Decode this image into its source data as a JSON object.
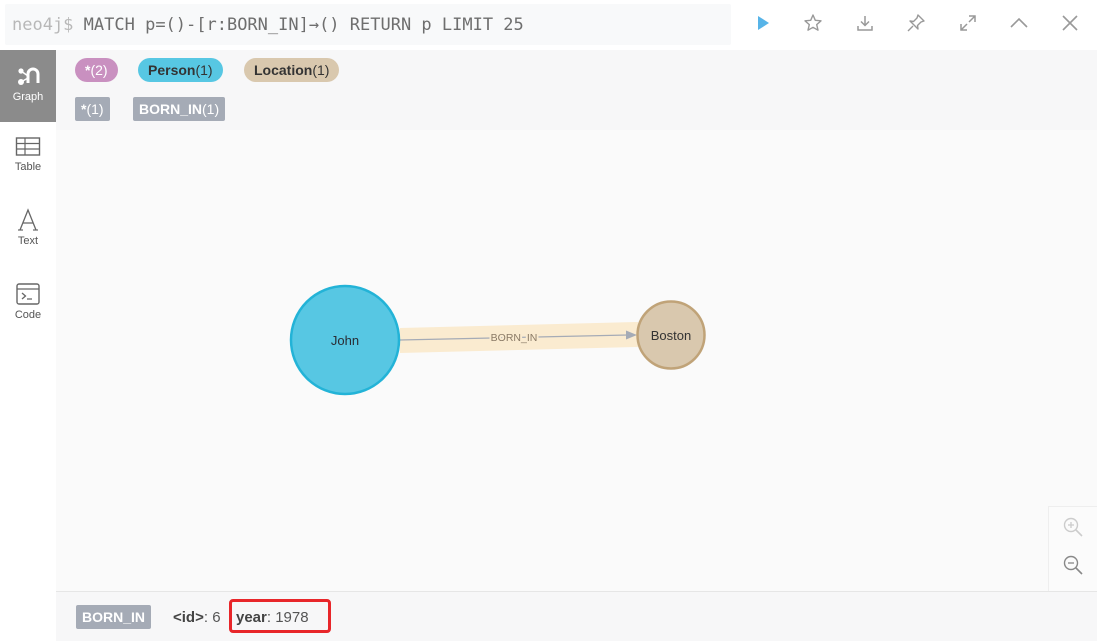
{
  "query": {
    "prompt": "neo4j$",
    "text": "MATCH p=()-[r:BORN_IN]→() RETURN p LIMIT 25"
  },
  "toolbar": {
    "icons": [
      "run-icon",
      "star-icon",
      "download-icon",
      "pin-icon",
      "expand-icon",
      "collapse-icon",
      "close-icon"
    ]
  },
  "sidebar": {
    "items": [
      {
        "label": "Graph",
        "icon": "graph-icon",
        "active": true
      },
      {
        "label": "Table",
        "icon": "table-icon"
      },
      {
        "label": "Text",
        "icon": "text-icon"
      },
      {
        "label": "Code",
        "icon": "code-icon"
      }
    ]
  },
  "legend": {
    "labels": [
      {
        "name": "*",
        "count": "(2)",
        "color": "#c990c0"
      },
      {
        "name": "Person",
        "count": "(1)",
        "color": "#57c7e3"
      },
      {
        "name": "Location",
        "count": "(1)",
        "color": "#d9c8ae"
      }
    ],
    "relationships": [
      {
        "name": "*",
        "count": "(1)"
      },
      {
        "name": "BORN_IN",
        "count": "(1)"
      }
    ]
  },
  "graph": {
    "nodes": [
      {
        "caption": "John",
        "color": "#57c7e3",
        "stroke": "#23b3d7"
      },
      {
        "caption": "Boston",
        "color": "#d9c8ae",
        "stroke": "#c0a378"
      }
    ],
    "relationship": {
      "type": "BORN_IN",
      "highlight": "#faebd0",
      "color": "#a5abb6"
    }
  },
  "status": {
    "badge": "BORN_IN",
    "id_key": "<id>",
    "id_value": ": 6",
    "year_key": "year",
    "year_value": ": 1978",
    "highlight_color": "#e8262a"
  }
}
